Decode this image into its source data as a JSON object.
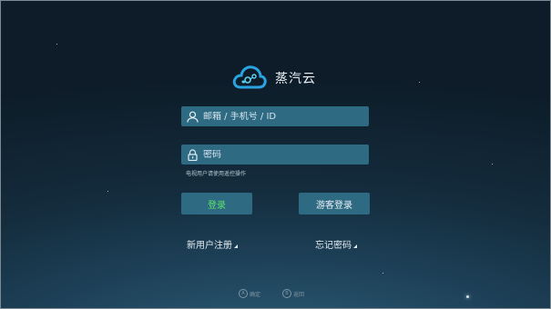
{
  "app": {
    "name": "蒸汽云",
    "logo_icon": "cloud-logo-icon"
  },
  "login_form": {
    "account_placeholder": "邮箱 / 手机号 / ID",
    "password_placeholder": "密码",
    "hint": "电视用户请使用遥控操作",
    "login_label": "登录",
    "guest_login_label": "游客登录",
    "register_label": "新用户注册",
    "forgot_password_label": "忘记密码"
  },
  "footer": {
    "confirm_key": "A",
    "confirm_label": "确定",
    "back_key": "B",
    "back_label": "返回"
  },
  "colors": {
    "accent": "#2f6a83",
    "login_text": "#5fe06a",
    "background": "#142c3d"
  }
}
